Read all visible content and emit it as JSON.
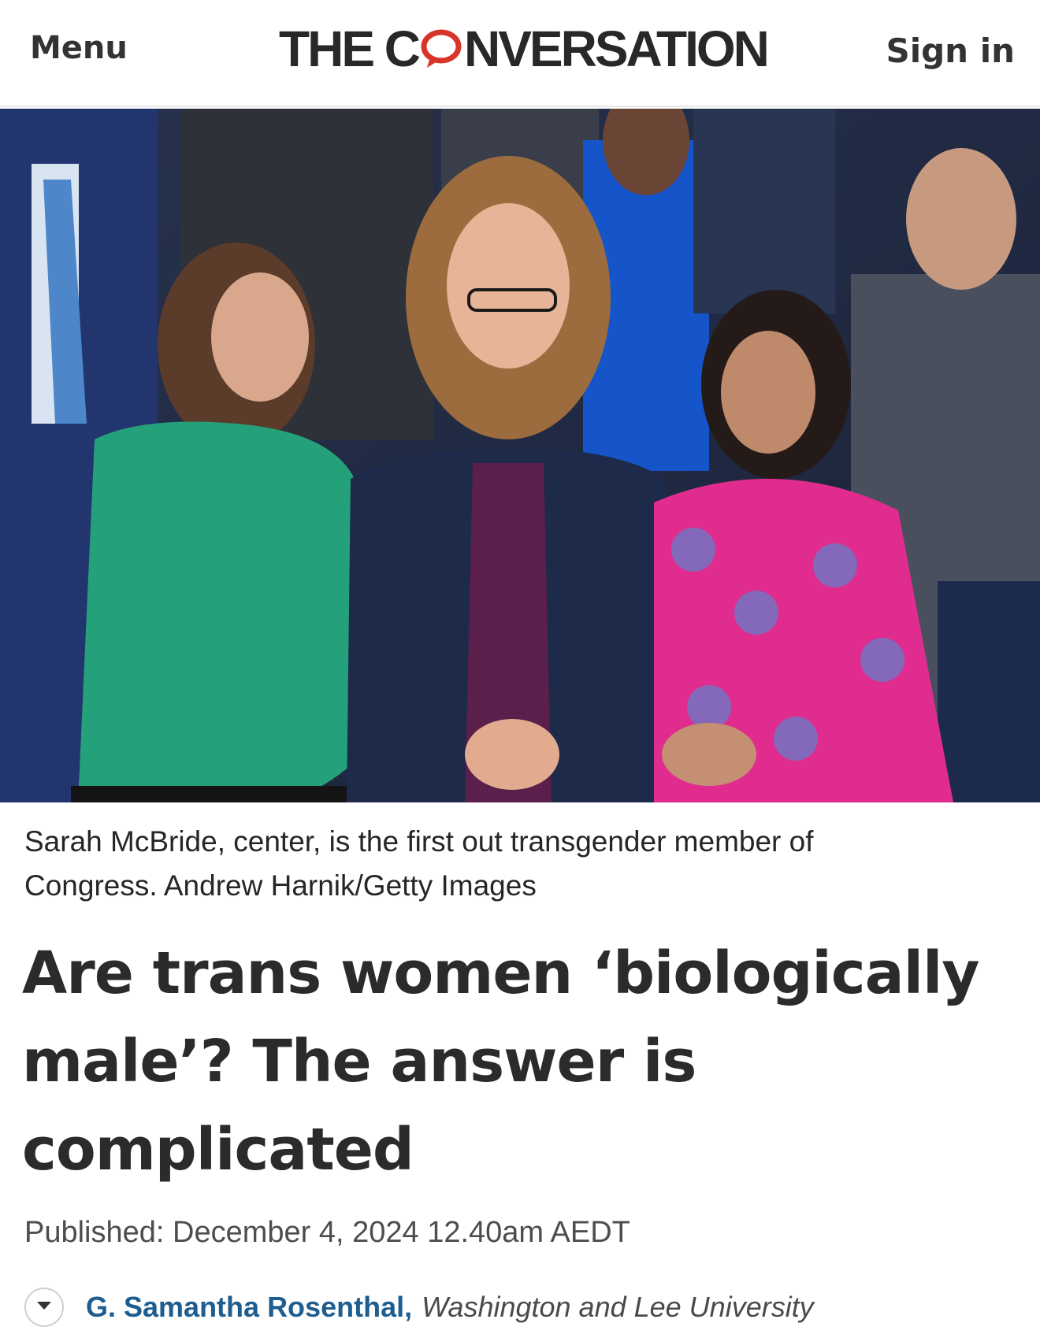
{
  "header": {
    "menu_label": "Menu",
    "logo_before": "THE C",
    "logo_after": "NVERSATION",
    "signin_label": "Sign in",
    "brand_accent": "#d8352a"
  },
  "hero": {
    "caption": "Sarah McBride, center, is the first out transgender member of Congress. Andrew Harnik/Getty Images"
  },
  "article": {
    "headline": "Are trans women ‘biologically male’? The answer is complicated",
    "published": "Published: December 4, 2024 12.40am AEDT",
    "author": {
      "name": "G. Samantha Rosenthal,",
      "affiliation": "Washington and Lee University",
      "toggle_icon": "chevron-down-icon",
      "link_color": "#1e5d8f"
    }
  }
}
